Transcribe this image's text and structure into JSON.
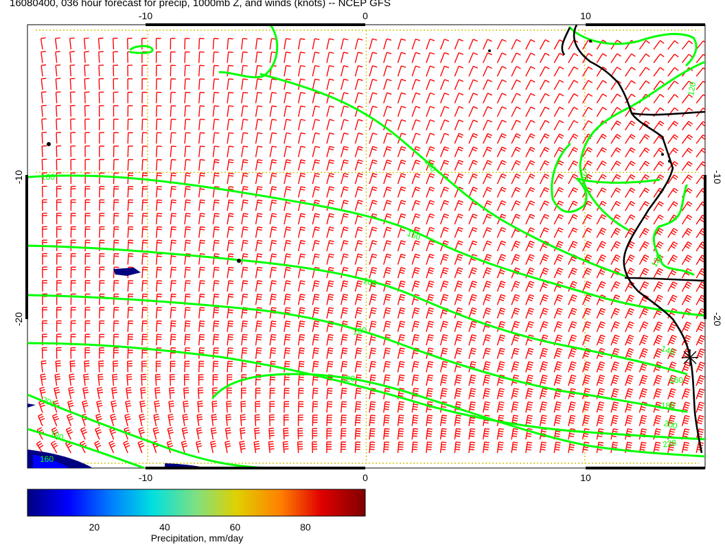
{
  "title": "16080400, 036 hour forecast for precip, 1000mb Z, and winds (knots) -- NCEP GFS",
  "map": {
    "lon_range": [
      -15.5,
      15.5
    ],
    "lat_range": [
      -30,
      0
    ],
    "gridlines": [
      -10,
      0,
      10
    ],
    "x_ticks_top": [
      "-10",
      "0",
      "10"
    ],
    "x_ticks_bottom": [
      "-10",
      "0",
      "10"
    ],
    "y_ticks_left": [
      "-10",
      "-20"
    ],
    "y_ticks_right": [
      "-10",
      "-20"
    ],
    "contour_labels": [
      "160",
      "140",
      "120",
      "120",
      "180",
      "200",
      "220",
      "200",
      "180",
      "160",
      "120",
      "160",
      "140",
      "160",
      "180",
      "200",
      "220"
    ],
    "colors": {
      "wind_barbs": "#ff0000",
      "contours": "#00ff00",
      "gridlines": "#d4c400",
      "coastline": "#000000",
      "precip_low": "#000080"
    }
  },
  "colorbar": {
    "ticks": [
      "20",
      "40",
      "60",
      "80"
    ],
    "tick_values": [
      20,
      40,
      60,
      80
    ],
    "range": [
      1,
      97
    ],
    "label": "Precipitation, mm/day"
  }
}
